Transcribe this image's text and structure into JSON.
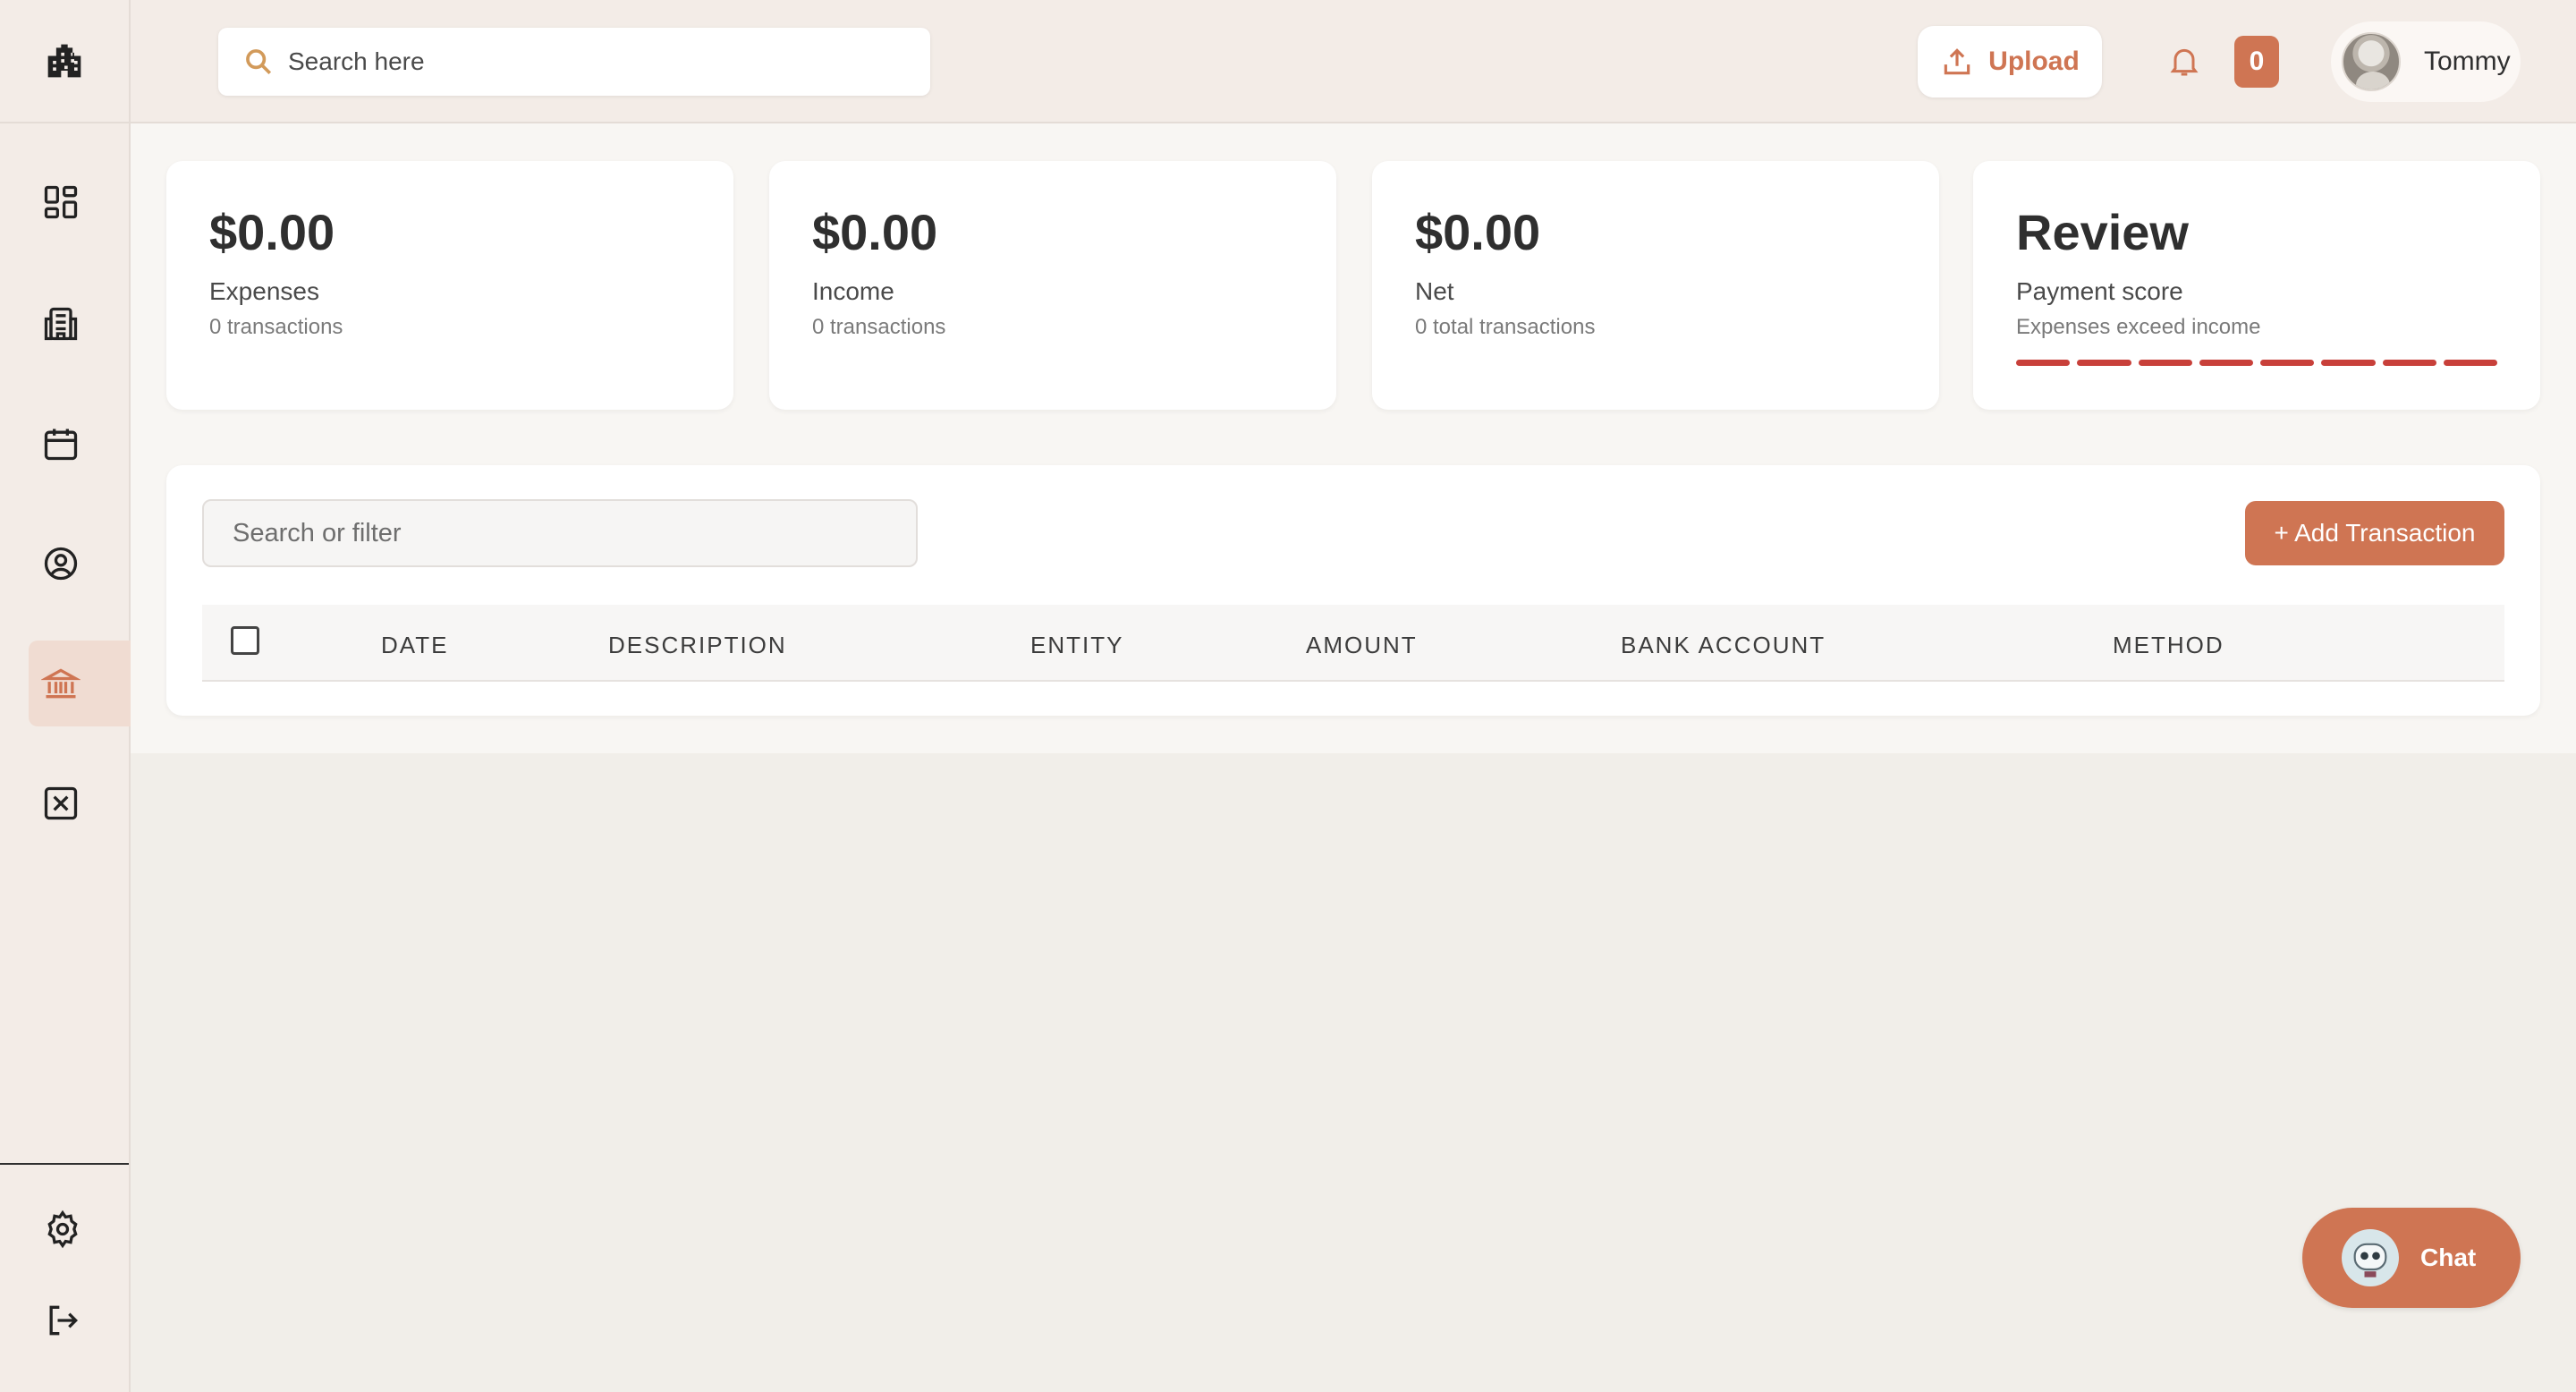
{
  "colors": {
    "accent": "#cf7553",
    "sidebar_bg": "#f3ece7",
    "active_nav_bg": "#f0dcd2",
    "score_bar": "#c8403a"
  },
  "sidebar": {
    "logo_icon": "building-icon",
    "items": [
      {
        "name": "dashboard",
        "icon": "grid-icon",
        "active": false
      },
      {
        "name": "documents",
        "icon": "building-document-icon",
        "active": false
      },
      {
        "name": "calendar",
        "icon": "calendar-icon",
        "active": false
      },
      {
        "name": "profile",
        "icon": "user-circle-icon",
        "active": false
      },
      {
        "name": "banking",
        "icon": "bank-icon",
        "active": true
      },
      {
        "name": "spreadsheet",
        "icon": "x-box-icon",
        "active": false
      }
    ],
    "bottom": [
      {
        "name": "settings",
        "icon": "gear-icon"
      },
      {
        "name": "logout",
        "icon": "logout-icon"
      }
    ]
  },
  "topbar": {
    "search_placeholder": "Search here",
    "upload_label": "Upload",
    "notification_count": "0",
    "user_name": "Tommy"
  },
  "cards": [
    {
      "value": "$0.00",
      "label": "Expenses",
      "sub": "0 transactions"
    },
    {
      "value": "$0.00",
      "label": "Income",
      "sub": "0 transactions"
    },
    {
      "value": "$0.00",
      "label": "Net",
      "sub": "0 total transactions"
    },
    {
      "value": "Review",
      "label": "Payment score",
      "sub": "Expenses exceed income",
      "score_segments": 8
    }
  ],
  "table": {
    "filter_placeholder": "Search or filter",
    "add_button_label": "+ Add Transaction",
    "columns": [
      "DATE",
      "DESCRIPTION",
      "ENTITY",
      "AMOUNT",
      "BANK ACCOUNT",
      "METHOD"
    ],
    "rows": []
  },
  "chat": {
    "label": "Chat"
  }
}
